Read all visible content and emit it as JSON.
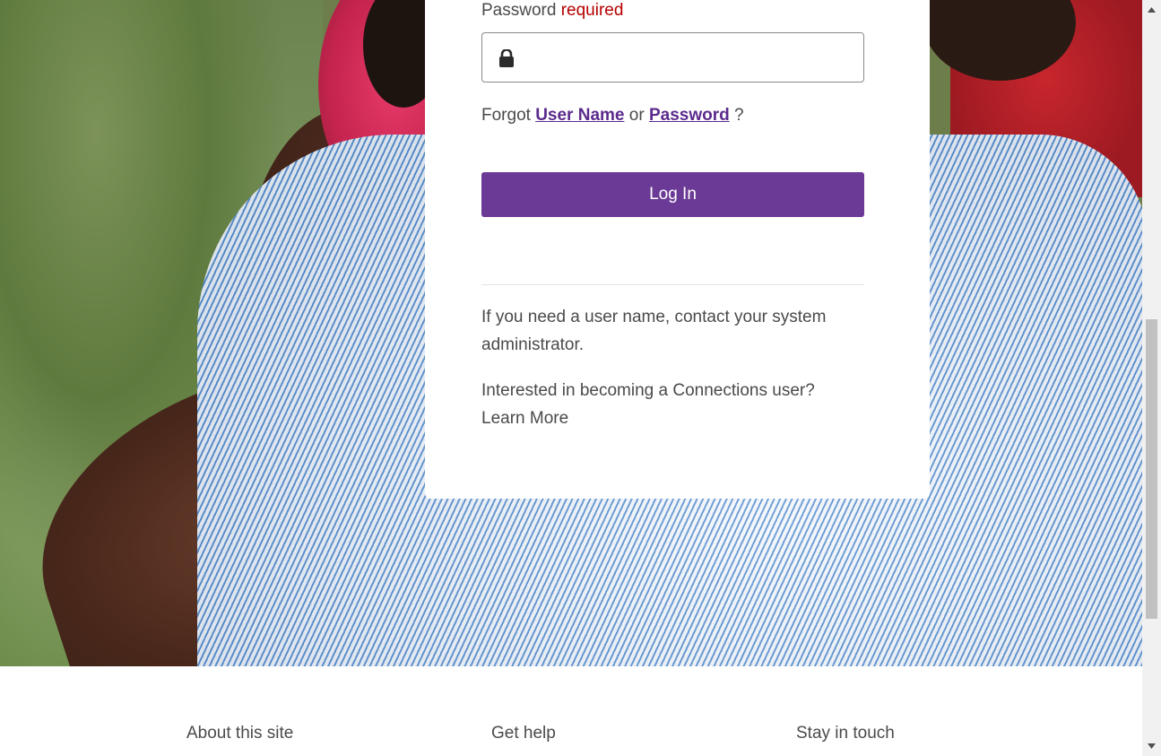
{
  "login": {
    "password_label": "Password",
    "required_label": "required",
    "password_value": "",
    "forgot_prefix": "Forgot",
    "forgot_username_link": "User Name",
    "forgot_or": "or",
    "forgot_password_link": "Password",
    "forgot_suffix": "?",
    "login_button": "Log In",
    "username_help": "If you need a user name, contact your system administrator.",
    "interested_text": "Interested in becoming a Connections user?",
    "learn_more_link": "Learn More"
  },
  "footer": {
    "headings": [
      "About this site",
      "Get help",
      "Stay in touch"
    ]
  },
  "icons": {
    "password_field": "lock-icon",
    "scroll_up": "arrow-up-icon",
    "scroll_down": "arrow-down-icon"
  },
  "colors": {
    "accent": "#6b3a96",
    "link": "#5b2a8c",
    "required": "#b50000",
    "text": "#4a4a4a"
  }
}
